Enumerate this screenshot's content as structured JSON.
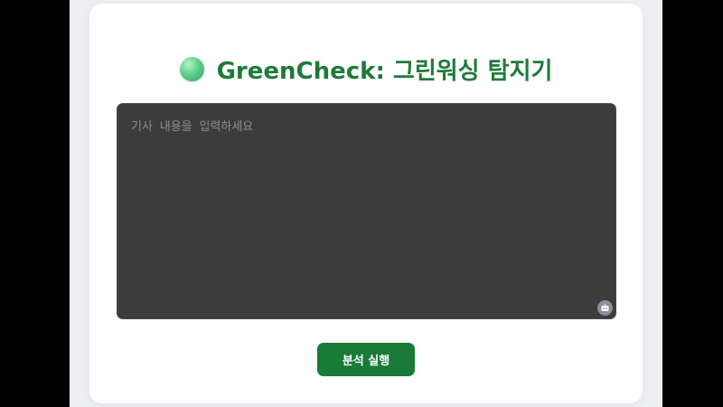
{
  "header": {
    "logo_icon": "green-sphere-icon",
    "title": "GreenCheck: 그린워싱 탐지기"
  },
  "form": {
    "article_placeholder": "기사 내용을 입력하세요",
    "article_value": "",
    "assistant_icon": "robot-icon",
    "submit_label": "분석 실행"
  },
  "colors": {
    "page_background": "#000000",
    "viewport_background": "#eeeff2",
    "card_background": "#ffffff",
    "title_color": "#1f7a3a",
    "input_background": "#3c3c3c",
    "button_background": "#1a7a37"
  }
}
